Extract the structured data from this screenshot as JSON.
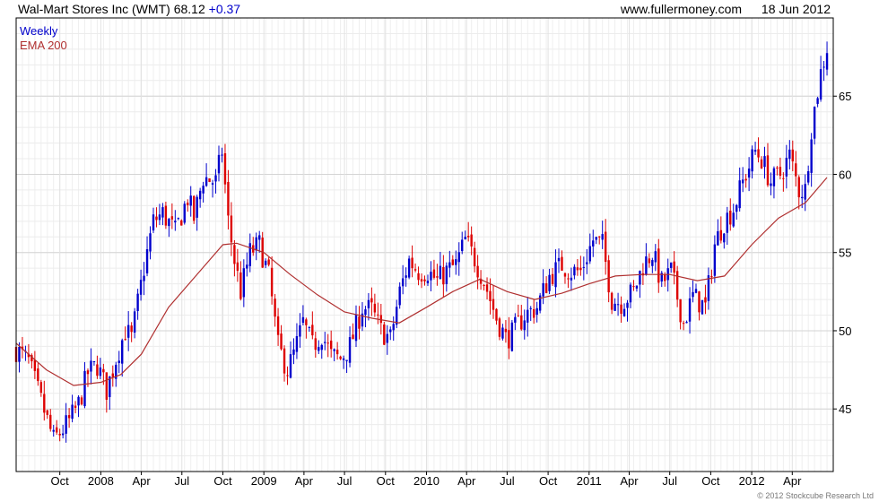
{
  "header": {
    "title": "Wal-Mart Stores Inc (WMT)",
    "price": "68.12",
    "change": "+0.37",
    "website": "www.fullermoney.com",
    "date": "18 Jun 2012"
  },
  "legend": {
    "weekly": "Weekly",
    "ema": "EMA 200"
  },
  "credit": "© 2012 Stockcube Research Ltd",
  "colors": {
    "up": "#0000cc",
    "down": "#dd0000",
    "ema": "#b03030",
    "grid": "#d4d4d4",
    "frame": "#000000"
  },
  "chart_data": {
    "type": "line",
    "title": "Wal-Mart Stores Inc (WMT)",
    "ylim": [
      41,
      70
    ],
    "y_ticks": [
      45,
      50,
      55,
      60,
      65
    ],
    "y_axis_side": "right",
    "grid": true,
    "legend_position": "top-left",
    "x_ticks": [
      {
        "label": "Oct",
        "date": "2007-10-01"
      },
      {
        "label": "2008",
        "date": "2008-01-01"
      },
      {
        "label": "Apr",
        "date": "2008-04-01"
      },
      {
        "label": "Jul",
        "date": "2008-07-01"
      },
      {
        "label": "Oct",
        "date": "2008-10-01"
      },
      {
        "label": "2009",
        "date": "2009-01-01"
      },
      {
        "label": "Apr",
        "date": "2009-04-01"
      },
      {
        "label": "Jul",
        "date": "2009-07-01"
      },
      {
        "label": "Oct",
        "date": "2009-10-01"
      },
      {
        "label": "2010",
        "date": "2010-01-01"
      },
      {
        "label": "Apr",
        "date": "2010-04-01"
      },
      {
        "label": "Jul",
        "date": "2010-07-01"
      },
      {
        "label": "Oct",
        "date": "2010-10-01"
      },
      {
        "label": "2011",
        "date": "2011-01-01"
      },
      {
        "label": "Apr",
        "date": "2011-04-01"
      },
      {
        "label": "Jul",
        "date": "2011-07-01"
      },
      {
        "label": "Oct",
        "date": "2011-10-01"
      },
      {
        "label": "2012",
        "date": "2012-01-01"
      },
      {
        "label": "Apr",
        "date": "2012-04-01"
      }
    ],
    "x_range": [
      "2007-06-25",
      "2012-07-02"
    ],
    "price_path": [
      [
        "2007-06-25",
        48.8
      ],
      [
        "2007-07-23",
        48.0
      ],
      [
        "2007-08-20",
        45.5
      ],
      [
        "2007-09-17",
        43.0
      ],
      [
        "2007-10-08",
        43.7
      ],
      [
        "2007-10-22",
        44.2
      ],
      [
        "2007-11-12",
        45.3
      ],
      [
        "2007-12-03",
        47.3
      ],
      [
        "2007-12-24",
        47.8
      ],
      [
        "2008-01-14",
        46.2
      ],
      [
        "2008-02-04",
        48.2
      ],
      [
        "2008-02-25",
        50.0
      ],
      [
        "2008-03-10",
        49.5
      ],
      [
        "2008-04-07",
        54.0
      ],
      [
        "2008-04-28",
        57.0
      ],
      [
        "2008-05-19",
        57.5
      ],
      [
        "2008-06-16",
        56.3
      ],
      [
        "2008-07-14",
        58.5
      ],
      [
        "2008-07-28",
        57.2
      ],
      [
        "2008-08-18",
        59.8
      ],
      [
        "2008-09-15",
        59.5
      ],
      [
        "2008-09-29",
        61.5
      ],
      [
        "2008-10-13",
        57.0
      ],
      [
        "2008-10-27",
        54.5
      ],
      [
        "2008-11-10",
        52.5
      ],
      [
        "2008-12-01",
        55.0
      ],
      [
        "2008-12-22",
        55.5
      ],
      [
        "2009-01-12",
        53.5
      ],
      [
        "2009-02-02",
        49.0
      ],
      [
        "2009-02-23",
        47.5
      ],
      [
        "2009-03-09",
        48.5
      ],
      [
        "2009-03-30",
        50.5
      ],
      [
        "2009-04-20",
        49.0
      ],
      [
        "2009-05-11",
        49.8
      ],
      [
        "2009-06-01",
        48.4
      ],
      [
        "2009-06-22",
        48.2
      ],
      [
        "2009-07-13",
        49.0
      ],
      [
        "2009-08-10",
        51.5
      ],
      [
        "2009-08-31",
        51.3
      ],
      [
        "2009-09-21",
        50.0
      ],
      [
        "2009-10-12",
        49.5
      ],
      [
        "2009-11-02",
        52.5
      ],
      [
        "2009-11-23",
        54.5
      ],
      [
        "2009-12-14",
        53.8
      ],
      [
        "2010-01-04",
        53.8
      ],
      [
        "2010-01-25",
        53.2
      ],
      [
        "2010-02-15",
        53.8
      ],
      [
        "2010-03-08",
        54.2
      ],
      [
        "2010-03-29",
        55.8
      ],
      [
        "2010-04-19",
        54.6
      ],
      [
        "2010-05-10",
        53.2
      ],
      [
        "2010-06-07",
        50.8
      ],
      [
        "2010-06-28",
        49.5
      ],
      [
        "2010-07-12",
        49.8
      ],
      [
        "2010-08-09",
        51.0
      ],
      [
        "2010-09-06",
        51.5
      ],
      [
        "2010-10-04",
        53.5
      ],
      [
        "2010-11-01",
        54.2
      ],
      [
        "2010-11-22",
        53.8
      ],
      [
        "2010-12-13",
        53.8
      ],
      [
        "2011-01-10",
        55.8
      ],
      [
        "2011-01-31",
        55.5
      ],
      [
        "2011-02-21",
        52.0
      ],
      [
        "2011-03-14",
        51.8
      ],
      [
        "2011-04-11",
        52.5
      ],
      [
        "2011-05-02",
        54.2
      ],
      [
        "2011-05-23",
        55.0
      ],
      [
        "2011-06-13",
        53.0
      ],
      [
        "2011-07-04",
        53.8
      ],
      [
        "2011-08-01",
        50.5
      ],
      [
        "2011-08-22",
        52.2
      ],
      [
        "2011-09-19",
        51.5
      ],
      [
        "2011-10-10",
        55.5
      ],
      [
        "2011-10-31",
        57.0
      ],
      [
        "2011-11-21",
        57.8
      ],
      [
        "2011-12-12",
        59.5
      ],
      [
        "2012-01-09",
        61.5
      ],
      [
        "2012-01-23",
        61.0
      ],
      [
        "2012-02-13",
        59.5
      ],
      [
        "2012-03-05",
        60.0
      ],
      [
        "2012-03-26",
        61.2
      ],
      [
        "2012-04-16",
        59.0
      ],
      [
        "2012-04-30",
        59.0
      ],
      [
        "2012-05-14",
        63.0
      ],
      [
        "2012-06-04",
        66.5
      ],
      [
        "2012-06-18",
        68.12
      ]
    ],
    "ema": [
      [
        "2007-06-25",
        49.2
      ],
      [
        "2007-09-01",
        47.5
      ],
      [
        "2007-11-01",
        46.5
      ],
      [
        "2008-01-01",
        46.7
      ],
      [
        "2008-02-15",
        47.2
      ],
      [
        "2008-04-01",
        48.5
      ],
      [
        "2008-06-01",
        51.5
      ],
      [
        "2008-08-01",
        53.5
      ],
      [
        "2008-10-01",
        55.5
      ],
      [
        "2008-11-01",
        55.6
      ],
      [
        "2009-01-01",
        55.0
      ],
      [
        "2009-03-01",
        53.6
      ],
      [
        "2009-05-01",
        52.3
      ],
      [
        "2009-07-01",
        51.2
      ],
      [
        "2009-09-01",
        50.8
      ],
      [
        "2009-11-01",
        50.5
      ],
      [
        "2010-01-01",
        51.5
      ],
      [
        "2010-03-01",
        52.5
      ],
      [
        "2010-05-01",
        53.3
      ],
      [
        "2010-07-01",
        52.5
      ],
      [
        "2010-09-01",
        52.0
      ],
      [
        "2010-11-01",
        52.4
      ],
      [
        "2011-01-01",
        53.0
      ],
      [
        "2011-03-01",
        53.5
      ],
      [
        "2011-05-01",
        53.6
      ],
      [
        "2011-07-01",
        53.6
      ],
      [
        "2011-09-01",
        53.2
      ],
      [
        "2011-11-01",
        53.5
      ],
      [
        "2012-01-01",
        55.5
      ],
      [
        "2012-03-01",
        57.2
      ],
      [
        "2012-05-01",
        58.2
      ],
      [
        "2012-06-18",
        59.8
      ]
    ]
  }
}
